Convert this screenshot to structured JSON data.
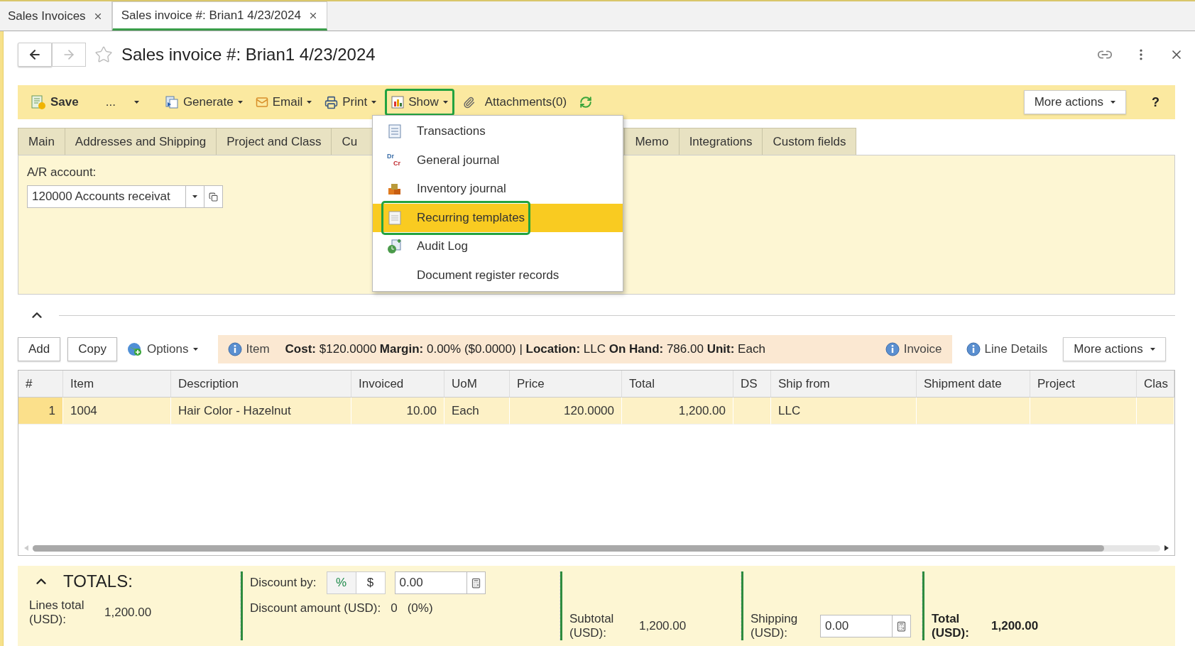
{
  "window_tabs": [
    {
      "label": "Sales Invoices",
      "selected": false
    },
    {
      "label": "Sales invoice #: Brian1 4/23/2024",
      "selected": true
    }
  ],
  "title": "Sales invoice #: Brian1 4/23/2024",
  "favorite": false,
  "toolbar": {
    "items": [
      {
        "kind": "save",
        "label": "Save"
      },
      {
        "kind": "more",
        "label": "..."
      },
      {
        "kind": "generate",
        "label": "Generate",
        "highlighted": false
      },
      {
        "kind": "email",
        "label": "Email",
        "highlighted": false
      },
      {
        "kind": "print",
        "label": "Print",
        "highlighted": false
      },
      {
        "kind": "show",
        "label": "Show",
        "highlighted": true
      },
      {
        "kind": "attach",
        "label": "Attachments(0)"
      },
      {
        "kind": "refresh"
      }
    ],
    "more_actions": "More actions",
    "help": "?"
  },
  "show_menu": [
    {
      "label": "Transactions",
      "kind": "list",
      "selected": false
    },
    {
      "label": "General journal",
      "kind": "drcr",
      "icon_text": [
        "Dr",
        "Cr"
      ],
      "selected": false
    },
    {
      "label": "Inventory journal",
      "kind": "boxes",
      "selected": false
    },
    {
      "label": "Recurring templates",
      "kind": "page",
      "selected": true
    },
    {
      "label": "Audit Log",
      "kind": "audit",
      "selected": false
    },
    {
      "label": "Document register records",
      "selected": false
    }
  ],
  "form_tabs": [
    {
      "label": "Main",
      "selected": false
    },
    {
      "label": "Addresses and Shipping",
      "selected": false
    },
    {
      "label": "Project and Class",
      "selected": false
    },
    {
      "label": "Cu",
      "selected": false
    },
    {
      "label": "Memo",
      "selected": false
    },
    {
      "label": "Integrations",
      "selected": false
    },
    {
      "label": "Custom fields",
      "selected": false
    }
  ],
  "ar_account": {
    "label": "A/R account:",
    "value": "120000 Accounts receivat"
  },
  "lines_toolbar": {
    "add": "Add",
    "copy": "Copy",
    "options": "Options",
    "item_label": "Item",
    "item_info": "**Cost:** $120.0000 **Margin:** 0.00% ($0.0000) | **Location:** LLC **On Hand:** 786.00 **Unit:** Each",
    "invoice": "Invoice",
    "line_details": "Line Details",
    "more_actions": "More actions"
  },
  "table": {
    "columns": [
      "#",
      "Item",
      "Description",
      "Invoiced",
      "UoM",
      "Price",
      "Total",
      "DS",
      "Ship from",
      "Shipment date",
      "Project",
      "Clas"
    ],
    "rows": [
      {
        "selected": true,
        "cells": [
          "1",
          "1004",
          "Hair Color - Hazelnut",
          "10.00",
          "Each",
          "120.0000",
          "1,200.00",
          "",
          "LLC",
          "",
          "",
          ""
        ]
      }
    ]
  },
  "totals": {
    "title": "TOTALS:",
    "lines_total_label": "Lines total (USD):",
    "lines_total": "1,200.00",
    "discount_by_label": "Discount by:",
    "discount_modes": [
      {
        "label": "%",
        "selected": true
      },
      {
        "label": "$",
        "selected": false
      }
    ],
    "discount_value": "0.00",
    "discount_amount_label": "Discount amount (USD):",
    "discount_amount": "0",
    "discount_percent": "(0%)",
    "subtotal_label": "Subtotal (USD):",
    "subtotal": "1,200.00",
    "shipping_label": "Shipping (USD):",
    "shipping": "0.00",
    "total_label": "Total (USD):",
    "total": "1,200.00"
  }
}
